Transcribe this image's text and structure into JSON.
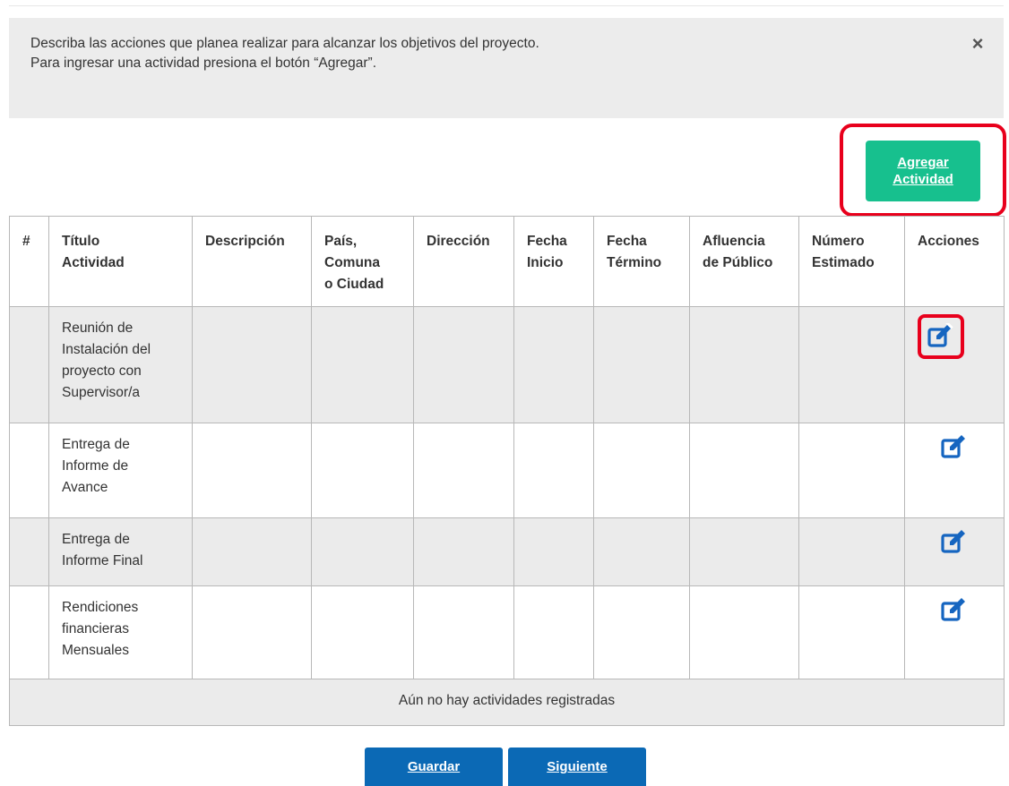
{
  "info": {
    "line1": "Describa las acciones que planea realizar para alcanzar los objetivos del proyecto.",
    "line2": "Para ingresar una actividad presiona el botón “Agregar”.",
    "close_icon": "close-icon"
  },
  "add_button": {
    "line1": "Agregar",
    "line2": "Actividad"
  },
  "table": {
    "headers": [
      {
        "line1": "#",
        "line2": "",
        "line3": ""
      },
      {
        "line1": "Título",
        "line2": "Actividad",
        "line3": ""
      },
      {
        "line1": "Descripción",
        "line2": "",
        "line3": ""
      },
      {
        "line1": "País,",
        "line2": "Comuna",
        "line3": "o Ciudad"
      },
      {
        "line1": "Dirección",
        "line2": "",
        "line3": ""
      },
      {
        "line1": "Fecha",
        "line2": "Inicio",
        "line3": ""
      },
      {
        "line1": "Fecha",
        "line2": "Término",
        "line3": ""
      },
      {
        "line1": "Afluencia",
        "line2": "de Público",
        "line3": ""
      },
      {
        "line1": "Número",
        "line2": "Estimado",
        "line3": ""
      },
      {
        "line1": "Acciones",
        "line2": "",
        "line3": ""
      }
    ],
    "rows": [
      {
        "title_lines": [
          "Reunión de",
          "Instalación del",
          "proyecto con",
          "Supervisor/a"
        ]
      },
      {
        "title_lines": [
          "Entrega de",
          "Informe de",
          "Avance",
          ""
        ]
      },
      {
        "title_lines": [
          "Entrega de",
          "Informe Final",
          "",
          ""
        ]
      },
      {
        "title_lines": [
          "Rendiciones",
          "financieras",
          "Mensuales",
          ""
        ]
      }
    ],
    "edit_icon": "edit-icon",
    "empty_message": "Aún no hay actividades registradas"
  },
  "buttons": {
    "save": "Guardar",
    "next": "Siguiente"
  },
  "colors": {
    "accent_green": "#17c08e",
    "primary_blue": "#0b69b5",
    "highlight_red": "#e8001c",
    "icon_blue": "#1565c0"
  }
}
